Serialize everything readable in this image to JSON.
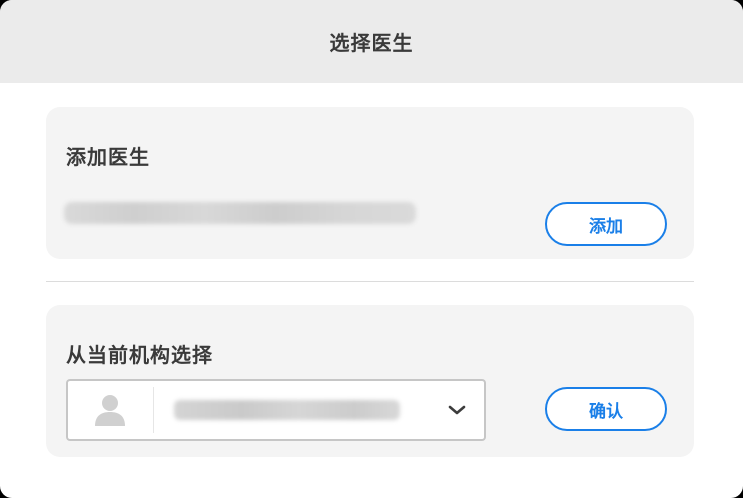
{
  "dialog": {
    "title": "选择医生"
  },
  "add_section": {
    "title": "添加医生",
    "email_value": "",
    "add_button_label": "添加"
  },
  "select_section": {
    "title": "从当前机构选择",
    "selected_doctor": "",
    "confirm_button_label": "确认"
  },
  "icons": {
    "avatar": "person-silhouette-icon",
    "dropdown": "chevron-down-icon"
  },
  "colors": {
    "accent": "#1a7fe8",
    "header_bg": "#ebebeb",
    "card_bg": "#f4f4f4",
    "title_text": "#3a3a3a"
  }
}
